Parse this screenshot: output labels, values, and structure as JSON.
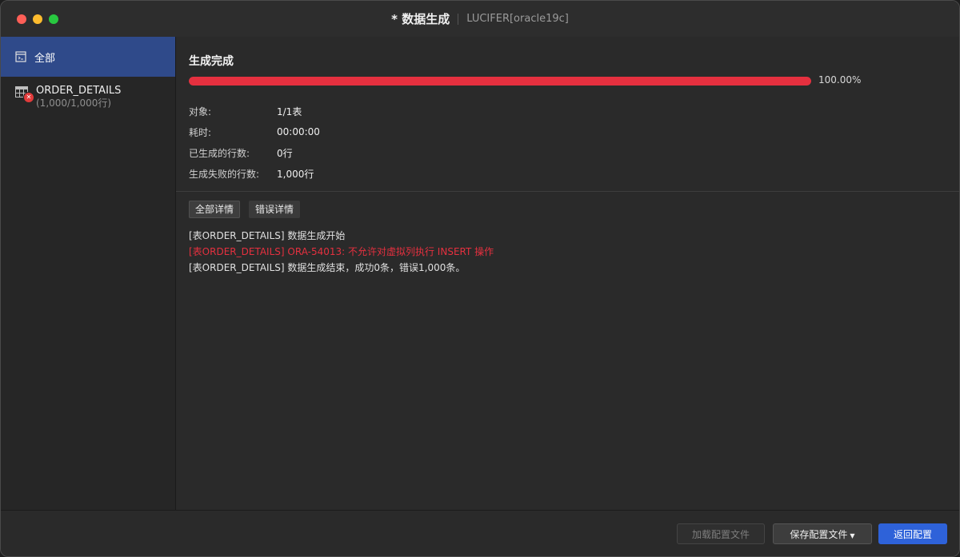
{
  "window": {
    "title": "* 数据生成",
    "subtitle": "LUCIFER[oracle19c]"
  },
  "sidebar": {
    "all_label": "全部",
    "items": [
      {
        "name": "ORDER_DETAILS",
        "count": "(1,000/1,000行)",
        "status": "error",
        "icon": "table-icon"
      }
    ]
  },
  "progress": {
    "title": "生成完成",
    "percent_text": "100.00%",
    "fraction": 1.0,
    "color": "#e5303f"
  },
  "stats": [
    {
      "label": "对象:",
      "value": "1/1表"
    },
    {
      "label": "耗时:",
      "value": "00:00:00"
    },
    {
      "label": "已生成的行数:",
      "value": "0行"
    },
    {
      "label": "生成失败的行数:",
      "value": "1,000行"
    }
  ],
  "tabs": [
    {
      "label": "全部详情",
      "active": true
    },
    {
      "label": "错误详情",
      "active": false
    }
  ],
  "logs": [
    {
      "text": "[表ORDER_DETAILS] 数据生成开始",
      "type": "info"
    },
    {
      "text": "[表ORDER_DETAILS] ORA-54013: 不允许对虚拟列执行 INSERT 操作",
      "type": "error"
    },
    {
      "text": "[表ORDER_DETAILS] 数据生成结束，成功0条，错误1,000条。",
      "type": "info"
    }
  ],
  "footer": {
    "load_label": "加载配置文件",
    "save_label": "保存配置文件",
    "back_label": "返回配置"
  },
  "colors": {
    "accent": "#2e62d9",
    "error": "#e5303f",
    "sidebar_selected": "#2f4a8a"
  }
}
